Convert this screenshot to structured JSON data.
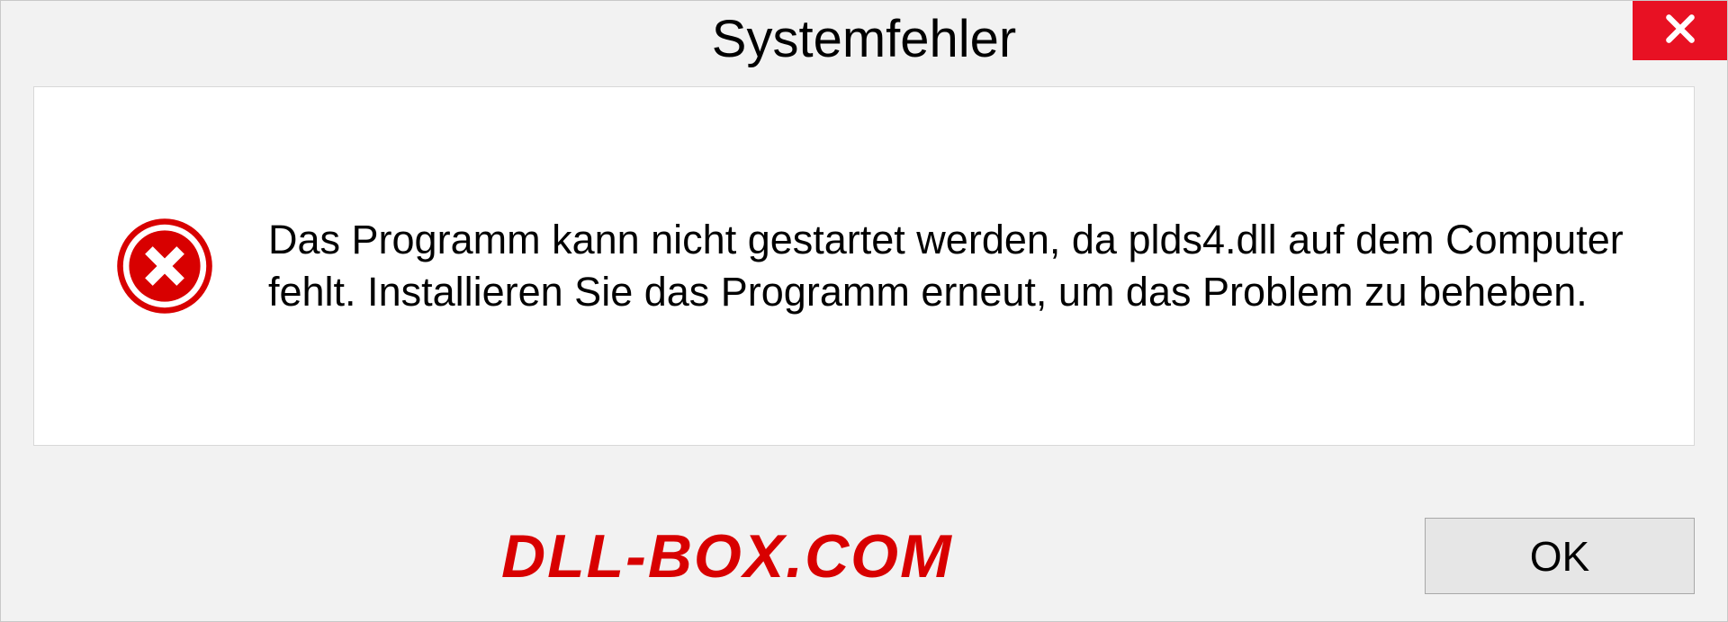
{
  "dialog": {
    "title": "Systemfehler",
    "message": "Das Programm kann nicht gestartet werden, da plds4.dll auf dem Computer fehlt. Installieren Sie das Programm erneut, um das Problem zu beheben.",
    "ok_label": "OK"
  },
  "watermark": "DLL-BOX.COM"
}
